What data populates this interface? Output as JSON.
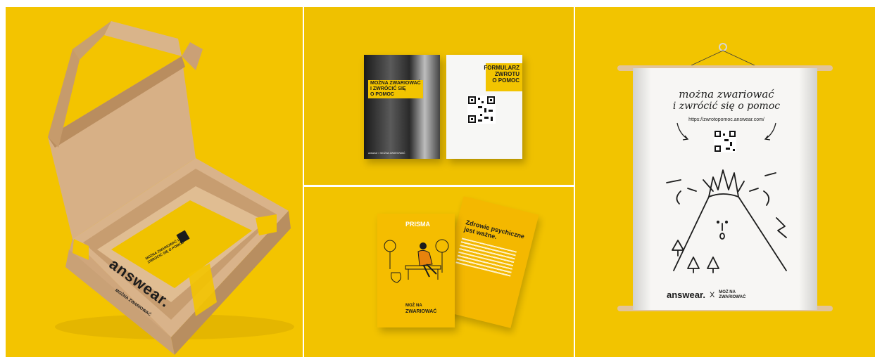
{
  "box": {
    "brand": "answear.",
    "sub_brand": "MOŻNA ZWARIOWAĆ",
    "card_text": "MOŻNA ZWARIOWAĆ I ZWRÓCIĆ SIĘ O POMOC"
  },
  "flyers": {
    "left_title_line1": "MOŻNA ZWARIOWAĆ",
    "left_title_line2": "I ZWRÓCIĆ SIĘ",
    "left_title_line3": "O POMOC",
    "right_title_line1": "FORMULARZ",
    "right_title_line2": "ZWROTU",
    "right_title_line3": "O POMOC",
    "footer_left": "answear × MOŻNA ZWARIOWAĆ"
  },
  "cards": {
    "brand_tag": "PRISMA",
    "back_title": "Zdrowie psychiczne jest ważne.",
    "front_logo_top": "MOŻ NA",
    "front_logo_bottom": "ZWARIOWAĆ"
  },
  "scroll": {
    "headline_line1": "można zwariować",
    "headline_line2": "i zwrócić się o pomoc",
    "url": "https://zwrotopomoc.answear.com/",
    "brand": "answear.",
    "times": "X",
    "partner_top": "MOŻ NA",
    "partner_bottom": "ZWARIOWAĆ"
  },
  "colors": {
    "yellow": "#f2c400",
    "kraft": "#c9a27a",
    "dark": "#1c1c1c"
  }
}
